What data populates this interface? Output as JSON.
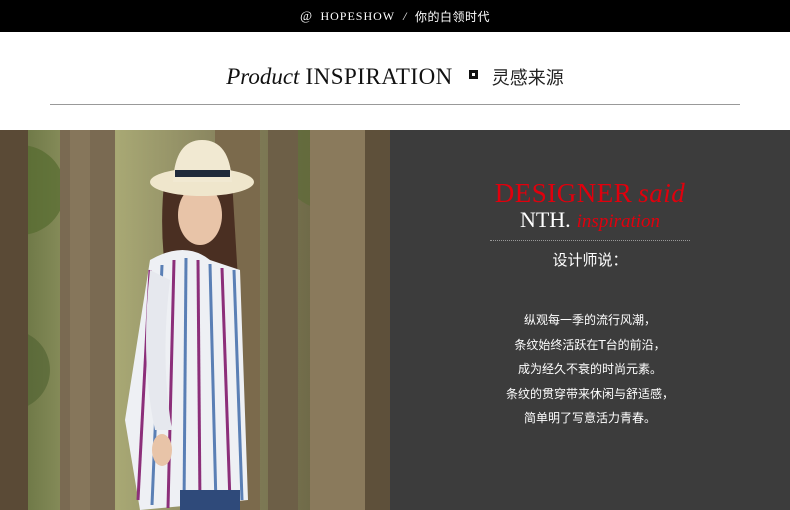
{
  "topbar": {
    "at_symbol": "@",
    "brand": "HOPESHOW",
    "separator": "/",
    "tagline": "你的白领时代"
  },
  "heading": {
    "product": "Product",
    "inspiration": "INSPIRATION",
    "chinese": "灵感来源"
  },
  "photo": {
    "alt": "model"
  },
  "panel": {
    "designer": "DESIGNER",
    "said": "said",
    "nth": "NTH.",
    "inspiration": "inspiration",
    "designer_says": "设计师说：",
    "lines": [
      "纵观每一季的流行风潮，",
      "条纹始终活跃在T台的前沿，",
      "成为经久不衰的时尚元素。",
      "条纹的贯穿带来休闲与舒适感，",
      "简单明了写意活力青春。"
    ]
  },
  "colors": {
    "top_bar": "#000000",
    "panel_bg": "#3c3c3c",
    "accent_red": "#e0000d"
  }
}
